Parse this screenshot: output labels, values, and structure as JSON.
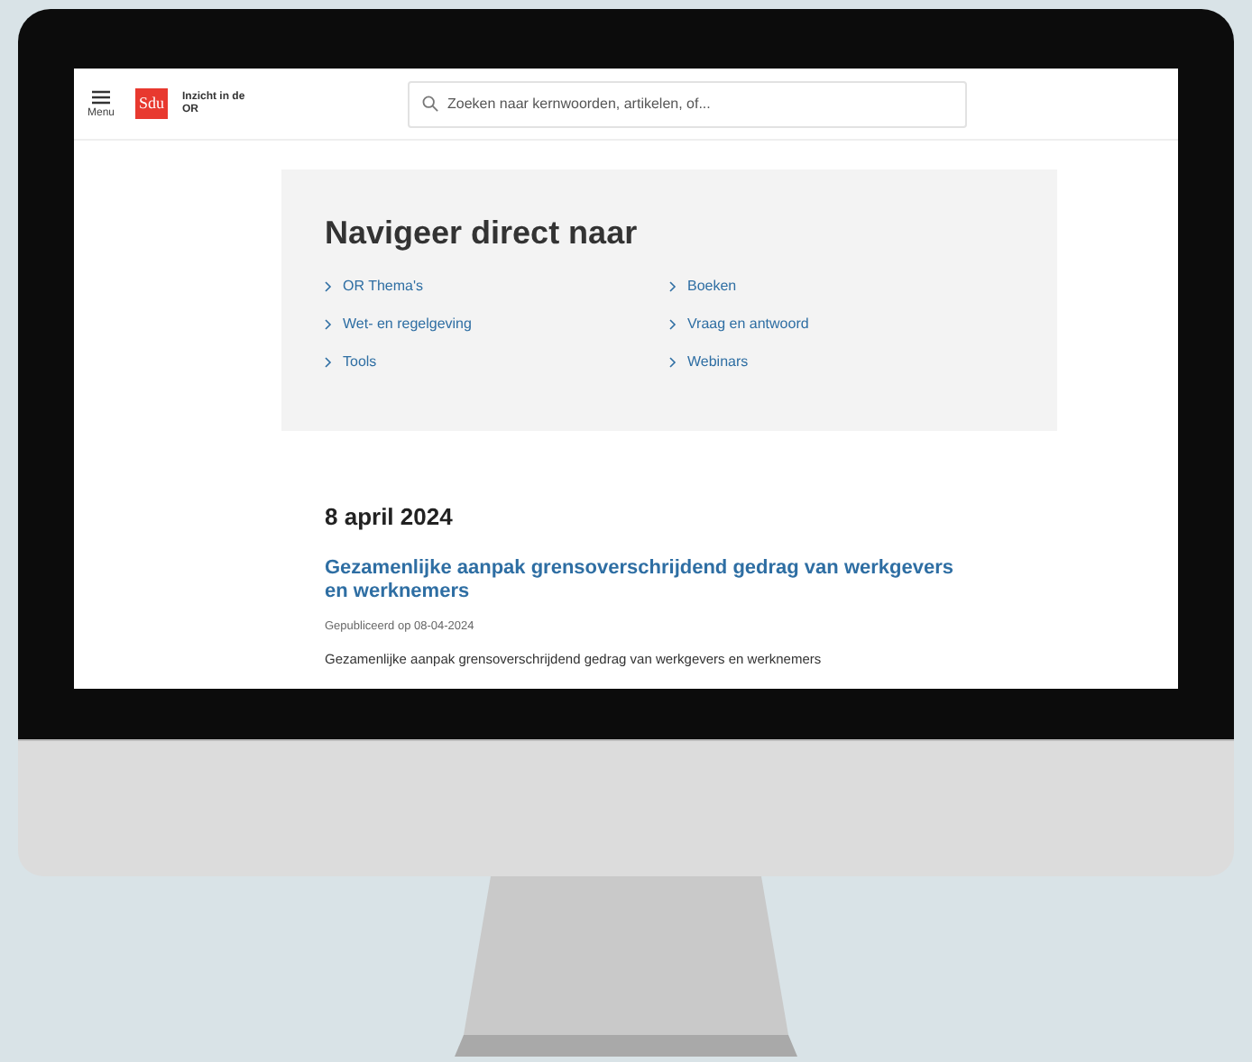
{
  "header": {
    "menu_label": "Menu",
    "logo_text": "Sdu",
    "site_title": "Inzicht in de OR",
    "search": {
      "placeholder": "Zoeken naar kernwoorden, artikelen, of..."
    }
  },
  "quick_nav": {
    "title": "Navigeer direct naar",
    "links": [
      {
        "label": "OR Thema's"
      },
      {
        "label": "Boeken"
      },
      {
        "label": "Wet- en regelgeving"
      },
      {
        "label": "Vraag en antwoord"
      },
      {
        "label": "Tools"
      },
      {
        "label": "Webinars"
      }
    ]
  },
  "news": {
    "date": "8 april 2024",
    "article": {
      "title": "Gezamenlijke aanpak grensoverschrijdend gedrag van werkgevers en werknemers",
      "published": "Gepubliceerd op 08-04-2024",
      "summary": "Gezamenlijke aanpak grensoverschrijdend gedrag van werkgevers en werknemers"
    }
  }
}
